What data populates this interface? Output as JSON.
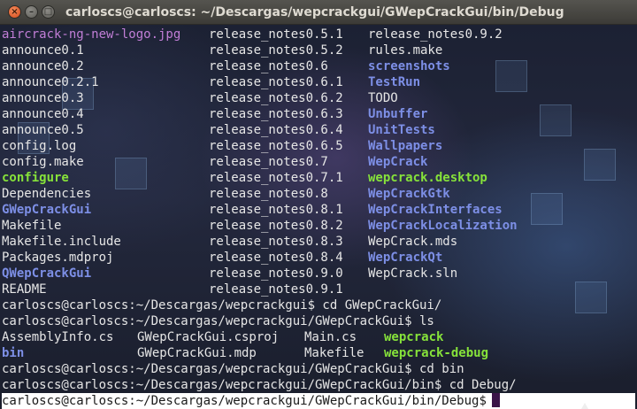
{
  "window": {
    "title": "carloscs@carloscs: ~/Descargas/wepcrackgui/GWepCrackGui/bin/Debug",
    "buttons": {
      "close": "×",
      "minimize": "–",
      "maximize": "□"
    }
  },
  "terminal": {
    "ls_rows": [
      [
        {
          "text": "aircrack-ng-new-logo.jpg",
          "kind": "image"
        },
        {
          "text": "release_notes0.5.1",
          "kind": "file"
        },
        {
          "text": "release_notes0.9.2",
          "kind": "file"
        }
      ],
      [
        {
          "text": "announce0.1",
          "kind": "file"
        },
        {
          "text": "release_notes0.5.2",
          "kind": "file"
        },
        {
          "text": "rules.make",
          "kind": "file"
        }
      ],
      [
        {
          "text": "announce0.2",
          "kind": "file"
        },
        {
          "text": "release_notes0.6",
          "kind": "file"
        },
        {
          "text": "screenshots",
          "kind": "dir"
        }
      ],
      [
        {
          "text": "announce0.2.1",
          "kind": "file"
        },
        {
          "text": "release_notes0.6.1",
          "kind": "file"
        },
        {
          "text": "TestRun",
          "kind": "dir"
        }
      ],
      [
        {
          "text": "announce0.3",
          "kind": "file"
        },
        {
          "text": "release_notes0.6.2",
          "kind": "file"
        },
        {
          "text": "TODO",
          "kind": "file"
        }
      ],
      [
        {
          "text": "announce0.4",
          "kind": "file"
        },
        {
          "text": "release_notes0.6.3",
          "kind": "file"
        },
        {
          "text": "Unbuffer",
          "kind": "dir"
        }
      ],
      [
        {
          "text": "announce0.5",
          "kind": "file"
        },
        {
          "text": "release_notes0.6.4",
          "kind": "file"
        },
        {
          "text": "UnitTests",
          "kind": "dir"
        }
      ],
      [
        {
          "text": "config.log",
          "kind": "file"
        },
        {
          "text": "release_notes0.6.5",
          "kind": "file"
        },
        {
          "text": "Wallpapers",
          "kind": "dir"
        }
      ],
      [
        {
          "text": "config.make",
          "kind": "file"
        },
        {
          "text": "release_notes0.7",
          "kind": "file"
        },
        {
          "text": "WepCrack",
          "kind": "dir"
        }
      ],
      [
        {
          "text": "configure",
          "kind": "exec"
        },
        {
          "text": "release_notes0.7.1",
          "kind": "file"
        },
        {
          "text": "wepcrack.desktop",
          "kind": "exec"
        }
      ],
      [
        {
          "text": "Dependencies",
          "kind": "file"
        },
        {
          "text": "release_notes0.8",
          "kind": "file"
        },
        {
          "text": "WepCrackGtk",
          "kind": "dir"
        }
      ],
      [
        {
          "text": "GWepCrackGui",
          "kind": "dir"
        },
        {
          "text": "release_notes0.8.1",
          "kind": "file"
        },
        {
          "text": "WepCrackInterfaces",
          "kind": "dir"
        }
      ],
      [
        {
          "text": "Makefile",
          "kind": "file"
        },
        {
          "text": "release_notes0.8.2",
          "kind": "file"
        },
        {
          "text": "WepCrackLocalization",
          "kind": "dir"
        }
      ],
      [
        {
          "text": "Makefile.include",
          "kind": "file"
        },
        {
          "text": "release_notes0.8.3",
          "kind": "file"
        },
        {
          "text": "WepCrack.mds",
          "kind": "file"
        }
      ],
      [
        {
          "text": "Packages.mdproj",
          "kind": "file"
        },
        {
          "text": "release_notes0.8.4",
          "kind": "file"
        },
        {
          "text": "WepCrackQt",
          "kind": "dir"
        }
      ],
      [
        {
          "text": "QWepCrackGui",
          "kind": "dir"
        },
        {
          "text": "release_notes0.9.0",
          "kind": "file"
        },
        {
          "text": "WepCrack.sln",
          "kind": "file"
        }
      ],
      [
        {
          "text": "README",
          "kind": "file"
        },
        {
          "text": "release_notes0.9.1",
          "kind": "file"
        },
        {
          "text": "",
          "kind": "file"
        }
      ]
    ],
    "commands": [
      "carloscs@carloscs:~/Descargas/wepcrackgui$ cd GWepCrackGui/",
      "carloscs@carloscs:~/Descargas/wepcrackgui/GWepCrackGui$ ls"
    ],
    "ls2_rows": [
      [
        {
          "text": "AssemblyInfo.cs",
          "kind": "file"
        },
        {
          "text": "GWepCrackGui.csproj",
          "kind": "file"
        },
        {
          "text": "Main.cs",
          "kind": "file"
        },
        {
          "text": "wepcrack",
          "kind": "exec"
        }
      ],
      [
        {
          "text": "bin",
          "kind": "dir"
        },
        {
          "text": "GWepCrackGui.mdp",
          "kind": "file"
        },
        {
          "text": "Makefile",
          "kind": "file"
        },
        {
          "text": "wepcrack-debug",
          "kind": "exec"
        }
      ]
    ],
    "commands2": [
      "carloscs@carloscs:~/Descargas/wepcrackgui/GWepCrackGui$ cd bin",
      "carloscs@carloscs:~/Descargas/wepcrackgui/GWepCrackGui/bin$ cd Debug/"
    ],
    "current_prompt": "carloscs@carloscs:~/Descargas/wepcrackgui/GWepCrackGui/bin/Debug$"
  },
  "colors": {
    "image": "#c17ed6",
    "dir": "#7d8fe6",
    "exec": "#86e23a",
    "text": "#e6e6e6"
  }
}
